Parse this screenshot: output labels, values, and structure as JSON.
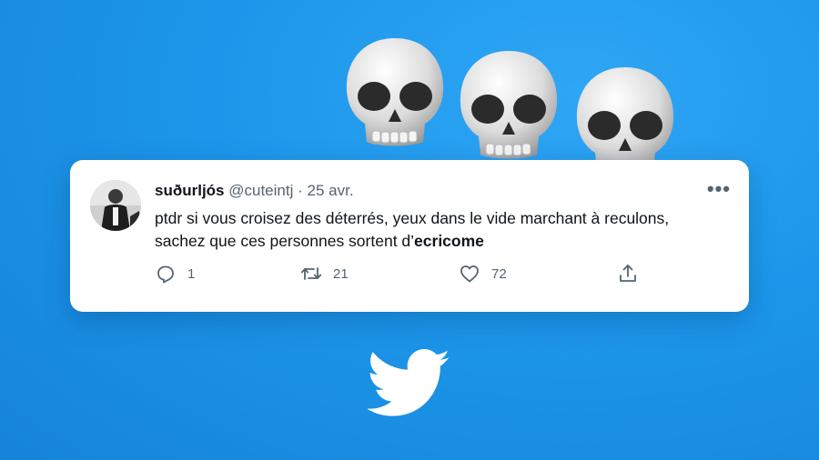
{
  "tweet": {
    "display_name": "suðurljós",
    "handle": "@cuteintj",
    "separator": "·",
    "date": "25 avr.",
    "more_icon": "more-horizontal-icon",
    "text_line1": "ptdr si vous croisez des déterrés, yeux dans le vide marchant à reculons,",
    "text_line2_prefix": "sachez que ces personnes sortent d’",
    "text_line2_bold": "ecricome",
    "actions": {
      "reply": {
        "icon": "reply-icon",
        "count": "1"
      },
      "retweet": {
        "icon": "retweet-icon",
        "count": "21"
      },
      "like": {
        "icon": "heart-icon",
        "count": "72"
      },
      "share": {
        "icon": "share-icon"
      }
    }
  },
  "decorations": {
    "skulls": [
      "skull-emoji",
      "skull-emoji",
      "skull-emoji"
    ],
    "logo": "twitter-bird-logo"
  },
  "colors": {
    "background": "#1d9bf0",
    "card": "#ffffff",
    "text": "#0f1419",
    "muted": "#536471"
  }
}
